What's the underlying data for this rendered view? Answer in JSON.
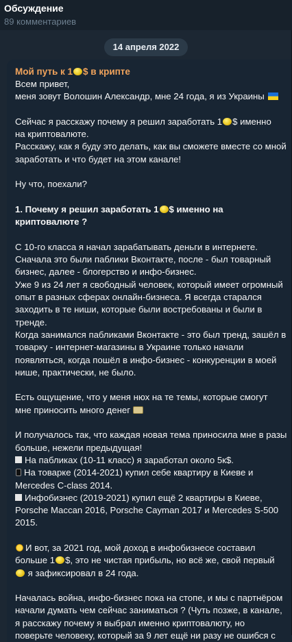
{
  "header": {
    "title": "Обсуждение",
    "subtitle": "89 комментариев"
  },
  "date_pill": "14 апреля 2022",
  "message": {
    "title_pre": "Мой путь к 1",
    "title_post": "$ в крипте",
    "l01": "Всем привет,",
    "l02": "меня зовут Волошин Александр, мне 24 года, я из Украины",
    "l03a": "Сейчас я расскажу почему я решил заработать  1",
    "l03b": "$  именно",
    "l04": "на криптовалюте.",
    "l05": "Расскажу, как я буду это делать, как вы сможете вместе со мной",
    "l06": "заработать и что будет на этом канале!",
    "l07": "Ну что, поехали?",
    "l08a": "1. Почему я решил заработать  1",
    "l08b": "$  именно на",
    "l09": "криптовалюте ?",
    "l10": "С 10-го класса я начал зарабатывать деньги в интернете.",
    "l11": "Сначала это были паблики Вконтакте, после - был товарный",
    "l12": "бизнес, далее - блогерство и инфо-бизнес.",
    "l13": "Уже 9 из 24 лет я свободный человек, который имеет огромный",
    "l14": "опыт в разных сферах онлайн-бизнеса. Я всегда старался",
    "l15": "заходить в те ниши, которые были востребованы и были в",
    "l16": "тренде.",
    "l17": "Когда занимался пабликами Вконтакте - это был тренд, зашёл в",
    "l18": "товарку - интернет-магазины в Украине только начали",
    "l19": "появляться, когда пошёл в инфо-бизнес - конкуренции в моей",
    "l20": "нише, практически, не было.",
    "l21": "Есть ощущение, что у меня нюх на те темы, которые смогут",
    "l22": "мне приносить много денег",
    "l23": "И получалось так, что каждая новая тема приносила мне в разы",
    "l24": "больше, нежели предыдущая!",
    "l25": "На пабликах (10-11 класс) я заработал около 5к$.",
    "l26": "На товарке (2014-2021) купил себе квартиру в Киеве и",
    "l27": "Mercedes C-class 2014.",
    "l28": "Инфобизнес (2019-2021) купил ещё 2 квартиры в Киеве,",
    "l29": "Porsche Maccan 2016, Porsche Cayman 2017 и Mercedes S-500",
    "l30": "2015.",
    "l31": "И вот, за 2021 год, мой доход в инфобизнесе составил",
    "l32a": "больше 1",
    "l32b": "$, это не чистая прибыль, но всё же, свой первый",
    "l33": " я зафиксировал в 24 года.",
    "l34": "Началась война, инфо-бизнес пока на стопе, и мы с партнёром",
    "l35": "начали думать чем сейчас заниматься ?  (Чуть позже, в канале,",
    "l36": "я расскажу почему я выбрал именно криптовалюту, но",
    "l37": "поверьте человеку, который за 9 лет ещё ни разу не ошибся с"
  }
}
